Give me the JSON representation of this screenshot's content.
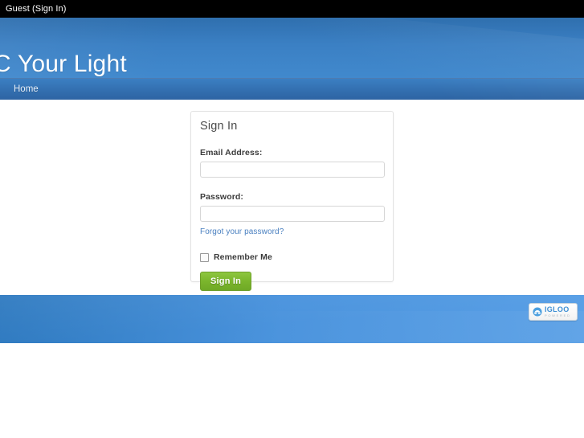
{
  "topbar": {
    "user_status": "Guest (Sign In)"
  },
  "header": {
    "site_title": "C Your Light"
  },
  "nav": {
    "items": [
      {
        "label": "Home"
      }
    ]
  },
  "signin": {
    "panel_title": "Sign In",
    "email_label": "Email Address:",
    "email_value": "",
    "email_placeholder": "",
    "password_label": "Password:",
    "password_value": "",
    "password_placeholder": "",
    "forgot_link": "Forgot your password?",
    "remember_label": "Remember Me",
    "remember_checked": false,
    "submit_label": "Sign In"
  },
  "footer": {
    "badge_word": "IGLOO",
    "badge_sub": "POWERED",
    "badge_icon": "igloo-dome-icon"
  },
  "colors": {
    "topbar_bg": "#000000",
    "header_blue": "#3b80c4",
    "nav_blue": "#336fb0",
    "footer_blue": "#4a93dd",
    "accent_green": "#7ab52c",
    "link_blue": "#4a80c0",
    "panel_border": "#e2e2e2"
  }
}
